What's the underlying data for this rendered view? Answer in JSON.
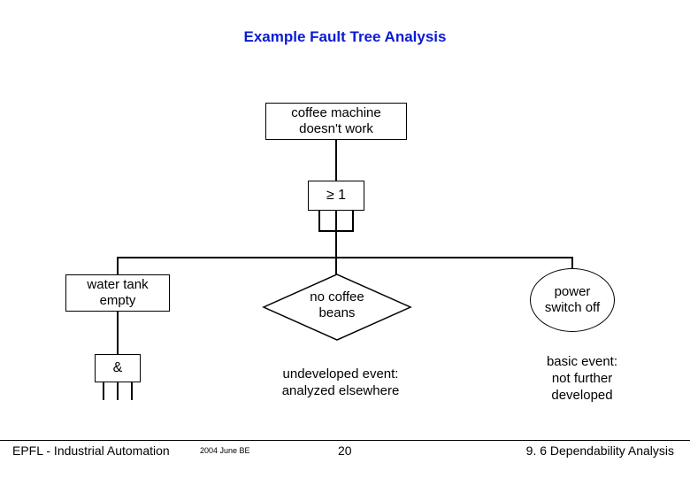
{
  "title": "Example Fault Tree Analysis",
  "top_event": "coffee machine\ndoesn't work",
  "or_gate_label": "≥ 1",
  "left_event": "water tank\nempty",
  "and_gate_label": "&",
  "middle_event": "no coffee\nbeans",
  "middle_caption": "undeveloped event:\nanalyzed elsewhere",
  "right_event": "power\nswitch off",
  "right_caption": "basic event:\nnot further\ndeveloped",
  "footer": {
    "left": "EPFL - Industrial Automation",
    "date": "2004 June BE",
    "page": "20",
    "right": "9. 6 Dependability Analysis"
  }
}
